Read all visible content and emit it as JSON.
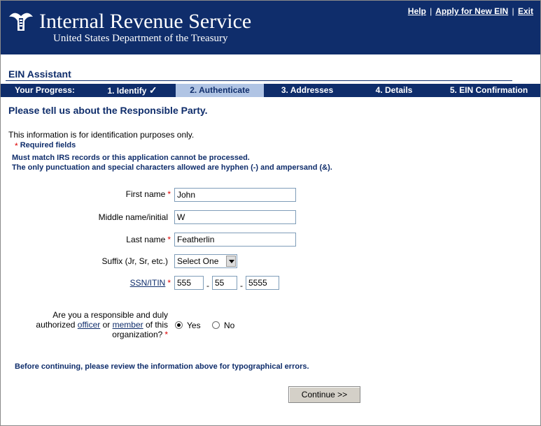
{
  "header": {
    "title": "Internal Revenue Service",
    "subtitle": "United States Department of the Treasury",
    "links": {
      "help": "Help",
      "apply": "Apply for New EIN",
      "exit": "Exit",
      "sep": "|"
    },
    "logo_icon": "irs-eagle-logo"
  },
  "app_title": "EIN Assistant",
  "progress": {
    "label": "Your Progress:",
    "steps": [
      "1. Identify",
      "2. Authenticate",
      "3. Addresses",
      "4. Details",
      "5. EIN Confirmation"
    ],
    "check": "✓",
    "active_index": 1
  },
  "page": {
    "heading": "Please tell us about the Responsible Party.",
    "info": "This information is for identification purposes only.",
    "required_star": "*",
    "required_label": "Required fields",
    "note1": "Must match IRS records or this application cannot be processed.",
    "note2": "The only punctuation and special characters allowed are hyphen (-) and ampersand (&)."
  },
  "form": {
    "first_name_label": "First name",
    "first_name": "John",
    "middle_label": "Middle name/initial",
    "middle": "W",
    "last_name_label": "Last name",
    "last_name": "Featherlin",
    "suffix_label": "Suffix (Jr, Sr, etc.)",
    "suffix_value": "Select One",
    "ssn_label": "SSN/ITIN",
    "ssn1": "555",
    "ssn2": "55",
    "ssn3": "5555",
    "dash": "-",
    "responsible_q1": "Are you a responsible and duly",
    "responsible_q2a": "authorized",
    "responsible_officer": "officer",
    "responsible_or": "or",
    "responsible_member": "member",
    "responsible_q2b": "of this",
    "responsible_q3": "organization?",
    "yes_label": "Yes",
    "no_label": "No",
    "selected": "Yes"
  },
  "review_note": "Before continuing, please review the information above for typographical errors.",
  "continue_label": "Continue >>",
  "colors": {
    "navy": "#0f2d6b",
    "active_step": "#b0c4e4",
    "required": "#dd0000"
  }
}
